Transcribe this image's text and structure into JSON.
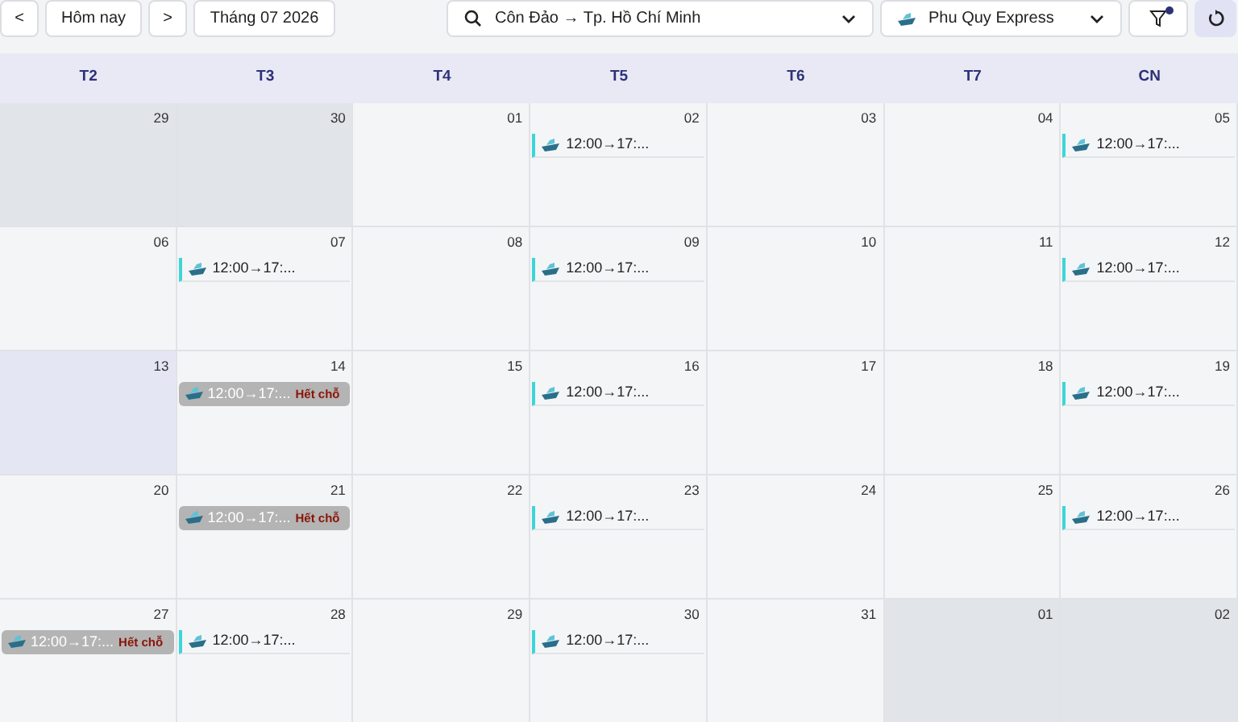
{
  "toolbar": {
    "prev": "<",
    "today": "Hôm nay",
    "next": ">",
    "month": "Tháng 07 2026",
    "route": "Côn Đảo → Tp. Hồ Chí Minh",
    "operator": "Phu Quy Express",
    "filter_active": true
  },
  "weekdays": [
    "T2",
    "T3",
    "T4",
    "T5",
    "T6",
    "T7",
    "CN"
  ],
  "weeks": [
    [
      {
        "day": "29",
        "kind": "outside"
      },
      {
        "day": "30",
        "kind": "outside"
      },
      {
        "day": "01",
        "kind": "normal"
      },
      {
        "day": "02",
        "kind": "normal",
        "events": [
          {
            "kind": "open",
            "time": "12:00→17:..."
          }
        ]
      },
      {
        "day": "03",
        "kind": "normal"
      },
      {
        "day": "04",
        "kind": "normal"
      },
      {
        "day": "05",
        "kind": "normal",
        "events": [
          {
            "kind": "open",
            "time": "12:00→17:..."
          }
        ]
      }
    ],
    [
      {
        "day": "06",
        "kind": "normal"
      },
      {
        "day": "07",
        "kind": "normal",
        "events": [
          {
            "kind": "open",
            "time": "12:00→17:..."
          }
        ]
      },
      {
        "day": "08",
        "kind": "normal"
      },
      {
        "day": "09",
        "kind": "normal",
        "events": [
          {
            "kind": "open",
            "time": "12:00→17:..."
          }
        ]
      },
      {
        "day": "10",
        "kind": "normal"
      },
      {
        "day": "11",
        "kind": "normal"
      },
      {
        "day": "12",
        "kind": "normal",
        "events": [
          {
            "kind": "open",
            "time": "12:00→17:..."
          }
        ]
      }
    ],
    [
      {
        "day": "13",
        "kind": "today"
      },
      {
        "day": "14",
        "kind": "normal",
        "events": [
          {
            "kind": "closed",
            "time": "12:00→17:...",
            "note": "Hết chỗ"
          }
        ]
      },
      {
        "day": "15",
        "kind": "normal"
      },
      {
        "day": "16",
        "kind": "normal",
        "events": [
          {
            "kind": "open",
            "time": "12:00→17:..."
          }
        ]
      },
      {
        "day": "17",
        "kind": "normal"
      },
      {
        "day": "18",
        "kind": "normal"
      },
      {
        "day": "19",
        "kind": "normal",
        "events": [
          {
            "kind": "open",
            "time": "12:00→17:..."
          }
        ]
      }
    ],
    [
      {
        "day": "20",
        "kind": "normal"
      },
      {
        "day": "21",
        "kind": "normal",
        "events": [
          {
            "kind": "closed",
            "time": "12:00→17:...",
            "note": "Hết chỗ"
          }
        ]
      },
      {
        "day": "22",
        "kind": "normal"
      },
      {
        "day": "23",
        "kind": "normal",
        "events": [
          {
            "kind": "open",
            "time": "12:00→17:..."
          }
        ]
      },
      {
        "day": "24",
        "kind": "normal"
      },
      {
        "day": "25",
        "kind": "normal"
      },
      {
        "day": "26",
        "kind": "normal",
        "events": [
          {
            "kind": "open",
            "time": "12:00→17:..."
          }
        ]
      }
    ],
    [
      {
        "day": "27",
        "kind": "normal",
        "events": [
          {
            "kind": "closed",
            "time": "12:00→17:...",
            "note": "Hết chỗ"
          }
        ]
      },
      {
        "day": "28",
        "kind": "normal",
        "events": [
          {
            "kind": "open",
            "time": "12:00→17:..."
          }
        ]
      },
      {
        "day": "29",
        "kind": "normal"
      },
      {
        "day": "30",
        "kind": "normal",
        "events": [
          {
            "kind": "open",
            "time": "12:00→17:..."
          }
        ]
      },
      {
        "day": "31",
        "kind": "normal"
      },
      {
        "day": "01",
        "kind": "outside"
      },
      {
        "day": "02",
        "kind": "outside"
      }
    ]
  ]
}
